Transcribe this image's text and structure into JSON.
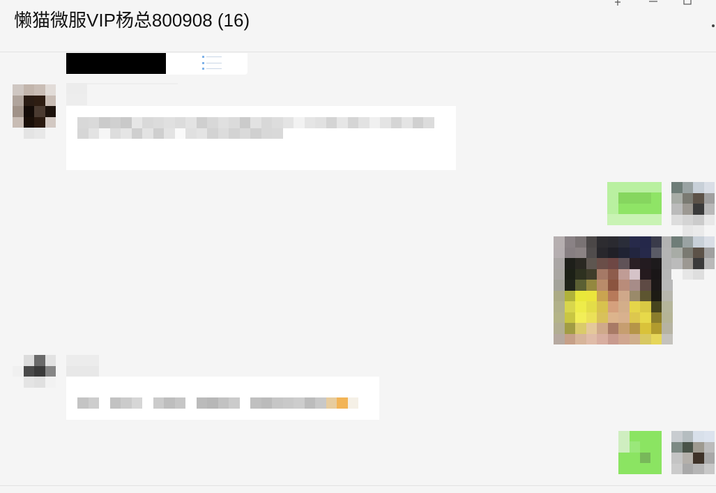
{
  "window": {
    "title": "懒猫微服VIP杨总800908 (16)",
    "icons": [
      "pin-icon",
      "minimize-icon",
      "maximize-icon",
      "more-icon"
    ]
  },
  "colors": {
    "background": "#f5f5f5",
    "bubble_incoming": "#ffffff",
    "bubble_outgoing": "#95ec69",
    "divider": "#e2e2e2"
  },
  "messages": [
    {
      "direction": "incoming",
      "kind": "image-card",
      "blurred": true
    },
    {
      "direction": "incoming",
      "kind": "text",
      "blurred": true
    },
    {
      "direction": "outgoing",
      "kind": "text",
      "blurred": true
    },
    {
      "direction": "outgoing",
      "kind": "image",
      "blurred": true
    },
    {
      "direction": "incoming",
      "kind": "text",
      "blurred": true
    },
    {
      "direction": "outgoing",
      "kind": "text",
      "blurred": true
    }
  ]
}
